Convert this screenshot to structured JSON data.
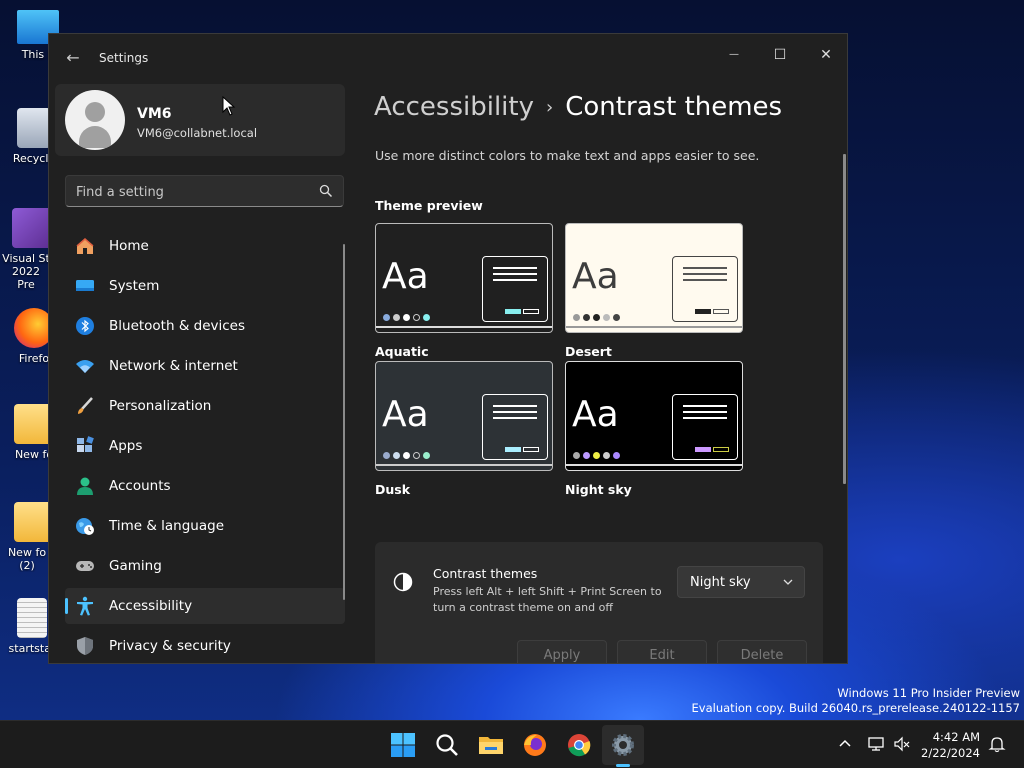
{
  "desktop": {
    "icons": [
      {
        "label": "This P"
      },
      {
        "label": "Recycle"
      },
      {
        "label": "Visual St 2022 Pre"
      },
      {
        "label": "Firefo"
      },
      {
        "label": "New fo"
      },
      {
        "label": "New fo (2)"
      },
      {
        "label": "startstar"
      }
    ],
    "watermark_line1": "Windows 11 Pro Insider Preview",
    "watermark_line2": "Evaluation copy. Build 26040.rs_prerelease.240122-1157"
  },
  "window": {
    "title": "Settings",
    "back_glyph": "←",
    "minimize_glyph": "—",
    "maximize_glyph": "☐",
    "close_glyph": "✕"
  },
  "profile": {
    "name": "VM6",
    "email": "VM6@collabnet.local"
  },
  "search": {
    "placeholder": "Find a setting"
  },
  "nav": {
    "items": [
      {
        "label": "Home",
        "icon": "home-icon"
      },
      {
        "label": "System",
        "icon": "system-icon"
      },
      {
        "label": "Bluetooth & devices",
        "icon": "bluetooth-icon"
      },
      {
        "label": "Network & internet",
        "icon": "wifi-icon"
      },
      {
        "label": "Personalization",
        "icon": "brush-icon"
      },
      {
        "label": "Apps",
        "icon": "apps-icon"
      },
      {
        "label": "Accounts",
        "icon": "accounts-icon"
      },
      {
        "label": "Time & language",
        "icon": "globe-icon"
      },
      {
        "label": "Gaming",
        "icon": "gamepad-icon"
      },
      {
        "label": "Accessibility",
        "icon": "accessibility-icon",
        "active": true
      },
      {
        "label": "Privacy & security",
        "icon": "shield-icon"
      }
    ]
  },
  "content": {
    "breadcrumb_parent": "Accessibility",
    "breadcrumb_sep": "›",
    "breadcrumb_current": "Contrast themes",
    "description": "Use more distinct colors to make text and apps easier to see.",
    "preview_title": "Theme preview",
    "sample_text": "Aa",
    "themes": [
      {
        "name": "Aquatic"
      },
      {
        "name": "Desert"
      },
      {
        "name": "Dusk"
      },
      {
        "name": "Night sky"
      }
    ],
    "setting": {
      "title": "Contrast themes",
      "description": "Press left Alt + left Shift + Print Screen to turn a contrast theme on and off",
      "selected_theme": "Night sky",
      "apply_label": "Apply",
      "edit_label": "Edit",
      "delete_label": "Delete"
    }
  },
  "taskbar": {
    "time": "4:42 AM",
    "date": "2/22/2024"
  },
  "colors": {
    "accent": "#4cc2ff",
    "window_bg": "#202020",
    "card_bg": "#2b2b2b"
  }
}
